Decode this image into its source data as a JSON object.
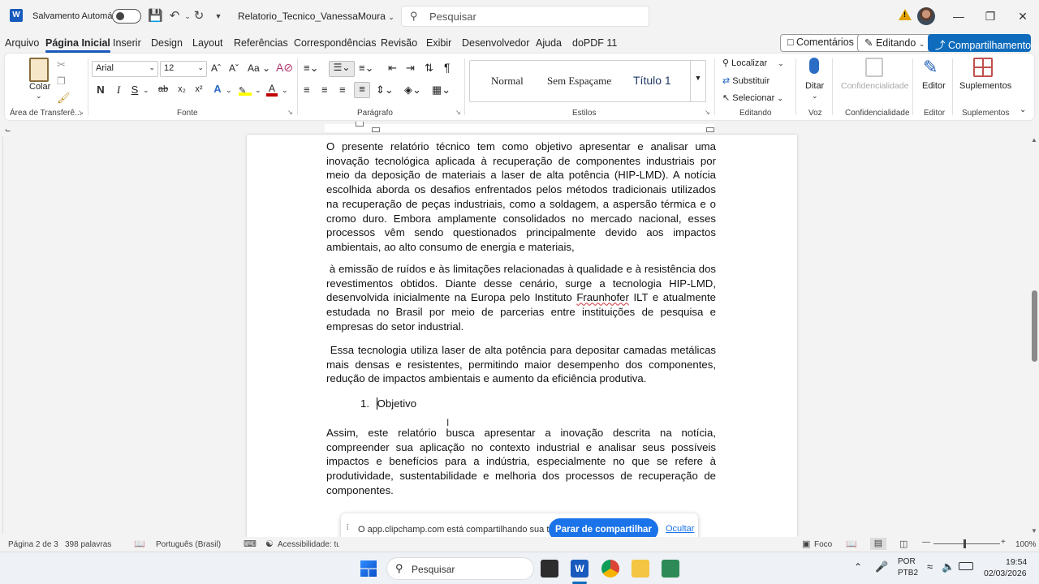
{
  "titlebar": {
    "autosave_label": "Salvamento Automático",
    "doc_title": "Relatorio_Tecnico_VanessaMoura",
    "search_placeholder": "Pesquisar"
  },
  "menu": {
    "tabs": [
      "Arquivo",
      "Página Inicial",
      "Inserir",
      "Design",
      "Layout",
      "Referências",
      "Correspondências",
      "Revisão",
      "Exibir",
      "Desenvolvedor",
      "Ajuda",
      "doPDF 11"
    ],
    "active_tab": "Página Inicial",
    "comments": "Comentários",
    "editing": "Editando",
    "share": "Compartilhamento"
  },
  "ribbon": {
    "clipboard": {
      "paste": "Colar",
      "group": "Área de Transferê..."
    },
    "font": {
      "name": "Arial",
      "size": "12",
      "group": "Fonte",
      "bold": "N",
      "italic": "I",
      "underline": "S"
    },
    "paragraph": {
      "group": "Parágrafo"
    },
    "styles": {
      "items": [
        "Normal",
        "Sem Espaçamento",
        "Título 1"
      ],
      "group": "Estilos"
    },
    "editing": {
      "find": "Localizar",
      "replace": "Substituir",
      "select": "Selecionar",
      "group": "Editando"
    },
    "voice": {
      "dictate": "Ditar",
      "group": "Voz"
    },
    "sensitivity": {
      "label": "Confidencialidade",
      "group": "Confidencialidade"
    },
    "editor": {
      "label": "Editor",
      "group": "Editor"
    },
    "addins": {
      "label": "Suplementos",
      "group": "Suplementos"
    }
  },
  "document": {
    "paragraphs": [
      "O presente relatório técnico tem como objetivo apresentar e analisar uma inovação tecnológica aplicada à recuperação de componentes industriais por meio da deposição de materiais a laser de alta potência (HIP-LMD). A notícia escolhida aborda os desafios enfrentados pelos métodos tradicionais utilizados na recuperação de peças industriais, como a soldagem, a aspersão térmica e o cromo duro. Embora amplamente consolidados no mercado nacional, esses processos vêm sendo questionados principalmente devido aos impactos ambientais, ao alto consumo de energia e materiais,",
      "à emissão de ruídos e às limitações relacionadas à qualidade e à resistência dos revestimentos obtidos. Diante desse cenário, surge a tecnologia HIP-LMD, desenvolvida inicialmente na Europa pelo Instituto",
      "Fraunhofer",
      "ILT e atualmente estudada no Brasil por meio de parcerias entre instituições de pesquisa e empresas do setor industrial.",
      "Essa tecnologia utiliza laser de alta potência para depositar camadas metálicas mais densas e resistentes, permitindo maior desempenho dos componentes, redução de impactos ambientais e aumento da eficiência produtiva.",
      "Assim, este relatório busca apresentar a inovação descrita na notícia, compreender sua aplicação no contexto industrial e analisar seus possíveis impactos e benefícios para a indústria, especialmente no que se refere à produtividade, sustentabilidade e melhoria dos processos de recuperação de componentes."
    ],
    "list_number": "1.",
    "list_text": "Objetivo"
  },
  "share_banner": {
    "message": "O app.clipchamp.com está compartilhando sua tela.",
    "stop_button": "Parar de compartilhar",
    "hide_link": "Ocultar"
  },
  "statusbar": {
    "page": "Página 2 de 3",
    "words": "398 palavras",
    "language": "Português (Brasil)",
    "accessibility": "Acessibilidade: tudo certo",
    "focus": "Foco",
    "zoom": "100%"
  },
  "taskbar": {
    "search_placeholder": "Pesquisar",
    "lang": "POR",
    "layout": "PTB2",
    "time": "19:54",
    "date": "02/03/2026"
  },
  "colors": {
    "brand": "#185abd",
    "share": "#0f6cbd",
    "banner_button": "#1a73e8"
  }
}
